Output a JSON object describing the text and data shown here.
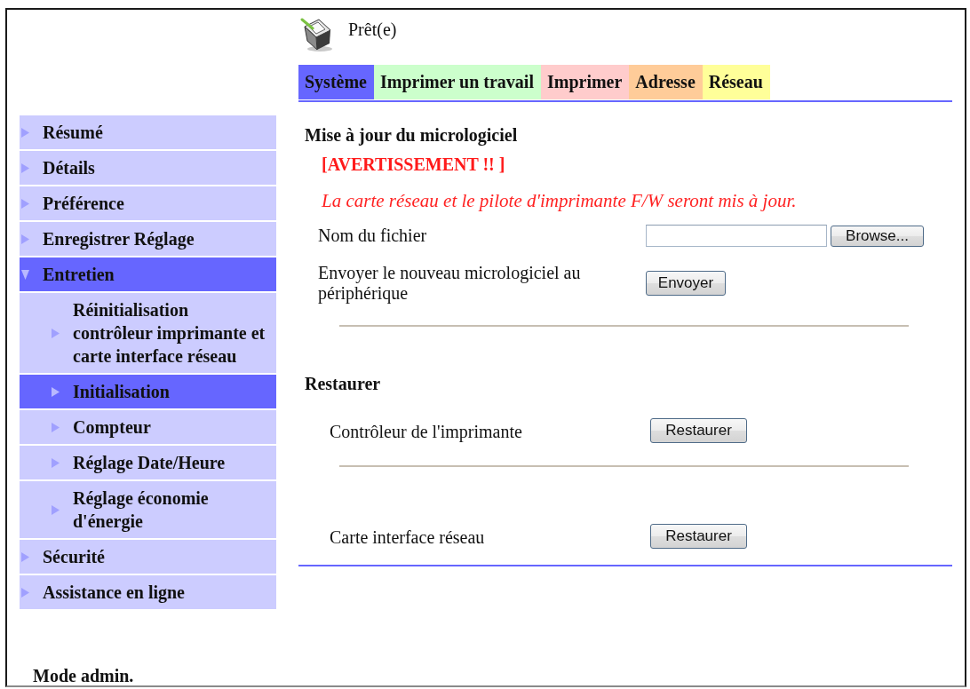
{
  "header": {
    "status": "Prêt(e)"
  },
  "tabs": [
    {
      "label": "Système",
      "color": "#6666ff"
    },
    {
      "label": "Imprimer un travail",
      "color": "#ccffcc"
    },
    {
      "label": "Imprimer",
      "color": "#ffcccc"
    },
    {
      "label": "Adresse",
      "color": "#ffcc99"
    },
    {
      "label": "Réseau",
      "color": "#ffff99"
    }
  ],
  "sidebar": {
    "items": [
      {
        "label": "Résumé",
        "selected": false,
        "expanded": false
      },
      {
        "label": "Détails",
        "selected": false,
        "expanded": false
      },
      {
        "label": "Préférence",
        "selected": false,
        "expanded": false
      },
      {
        "label": "Enregistrer Réglage",
        "selected": false,
        "expanded": false
      },
      {
        "label": "Entretien",
        "selected": true,
        "expanded": true,
        "children": [
          {
            "label": "Réinitialisation contrôleur imprimante et carte interface réseau",
            "selected": false
          },
          {
            "label": "Initialisation",
            "selected": true
          },
          {
            "label": "Compteur",
            "selected": false
          },
          {
            "label": "Réglage Date/Heure",
            "selected": false
          },
          {
            "label": "Réglage économie d'énergie",
            "selected": false
          }
        ]
      },
      {
        "label": "Sécurité",
        "selected": false,
        "expanded": false
      },
      {
        "label": "Assistance en ligne",
        "selected": false,
        "expanded": false
      }
    ],
    "mode": "Mode admin."
  },
  "firmware_update": {
    "title": "Mise à jour du micrologiciel",
    "warning_title": "[AVERTISSEMENT !! ]",
    "warning_text": "La carte réseau et le pilote d'imprimante F/W seront mis à jour.",
    "file_label": "Nom du fichier",
    "browse_button": "Browse...",
    "send_label": "Envoyer le nouveau micrologiciel au périphérique",
    "send_button": "Envoyer"
  },
  "restore": {
    "title": "Restaurer",
    "rows": [
      {
        "label": "Contrôleur de l'imprimante",
        "button": "Restaurer"
      },
      {
        "label": "Carte interface réseau",
        "button": "Restaurer"
      }
    ]
  }
}
